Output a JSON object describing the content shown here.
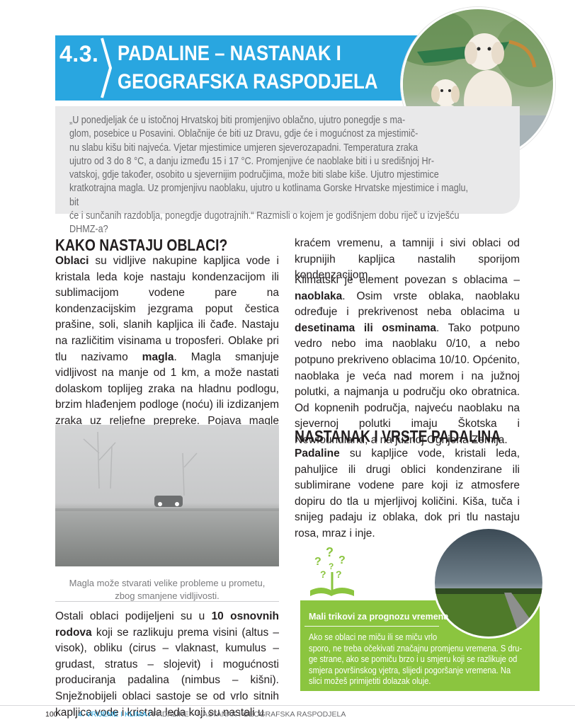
{
  "header": {
    "number": "4.3.",
    "title_line1": "PADALINE – NASTANAK I",
    "title_line2": "GEOGRAFSKA RASPODJELA"
  },
  "intro": {
    "lines": [
      "„U ponedjeljak će u istočnoj Hrvatskoj biti promjenjivo oblačno, ujutro ponegdje s ma-",
      "glom, posebice u Posavini. Oblačnije će biti uz Dravu, gdje će i mogućnost za mjestimič-",
      "nu slabu kišu biti najveća. Vjetar mjestimice umjeren sjeverozapadni. Temperatura zraka",
      "ujutro od 3 do 8 °C, a danju između 15 i 17 °C. Promjenjive će naoblake biti i u središnjoj Hr-",
      "vatskoj, gdje također, osobito u sjevernijim područjima, može biti slabe kiše. Ujutro mjestimice",
      "kratkotrajna magla. Uz promjenjivu naoblaku, ujutro u kotlinama Gorske Hrvatske mjestimice i maglu, bit",
      "će i sunčanih razdoblja, ponegdje dugotrajnih.“ Razmisli o kojem je godišnjem dobu riječ u izvješću DHMZ-a?"
    ]
  },
  "section1": {
    "heading": "KAKO NASTAJU OBLACI?",
    "p1": {
      "t1": "Oblaci",
      "t2": " su vidljive nakupine kapljica vode i kristala leda koje nastaju kondenzacijom ili sublimacijom vodene pare na kondenzacijskim jezgrama poput čestica prašine, soli, slanih kapljica ili čađe. Nastaju na različitim visinama u troposferi. Oblake pri tlu nazivamo ",
      "t3": "magla",
      "t4": ". Magla smanjuje vidljivost na manje od 1 km, a može nastati dolaskom toplijeg zraka na hladnu podlogu, brzim hlađenjem podloge (noću) ili izdizanjem zraka uz reljefne prepreke. Pojava magle iznad mora češća je u toplom dijelu godine, dok je na kopnu češća zimi."
    },
    "caption_line1": "Magla može stvarati velike probleme u prometu,",
    "caption_line2": "zbog smanjene vidljivosti.",
    "p2": {
      "t1": "Ostali oblaci podijeljeni su u ",
      "t2": "10 osnovnih rodova",
      "t3": " koji se razlikuju prema visini (altus – visok), obliku (cirus – vlaknast, kumulus – grudast, stratus – slojevit) i mogućnosti produciranja padalina (nimbus – kišni). Snježnobijeli oblaci sastoje se od vrlo sitnih kapljica vode i kristala leda koji su nastali u"
    }
  },
  "right_col": {
    "p1": "kraćem vremenu, a tamniji i sivi oblaci od krupnijih kapljica nastalih sporijom kondenzacijom.",
    "p2": {
      "t1": "Klimatski je element povezan s oblacima – ",
      "t2": "naoblaka",
      "t3": ". Osim vrste oblaka, naoblaku određuje i prekrivenost neba oblacima u ",
      "t4": "desetinama ili osminama",
      "t5": ". Tako potpuno vedro nebo ima naoblaku 0/10, a nebo potpuno prekriveno oblacima 10/10. Općenito, naoblaka je veća nad morem i na južnoj polutki, a najmanja u području oko obratnica. Od kopnenih područja, najveću naoblaku na sjevernoj polutki imaju Škotska i Newfoundland, a na južnoj Ognjena Zemlja."
    }
  },
  "section2": {
    "heading": "NASTANAK I VRSTE PADALINA",
    "p1": {
      "t1": "Padaline",
      "t2": " su kapljice vode, kristali leda, pahuljice ili drugi oblici kondenzirane ili sublimirane vodene pare koji iz atmosfere dopiru do tla u mjerljivoj količini. Kiša, tuča i snijeg padaju iz oblaka, dok pri tlu nastaju rosa, mraz i inje."
    }
  },
  "tip": {
    "heading": "Mali trikovi za prognozu vremena",
    "lines": [
      "Ako se oblaci ne miču ili se miču vrlo",
      "sporo, ne treba očekivati značajnu promjenu vremena. S dru-",
      "ge strane, ako se pomiču brzo i u smjeru koji se razlikuje od",
      "smjera površinskog vjetra, slijedi pogoršanje vremena. Na",
      "slici možeš primijetiti dolazak oluje."
    ]
  },
  "footer": {
    "page": "100",
    "chapter": "4. VRIJEME I KLIMA",
    "separator": " / ",
    "section": "PADALINE – NASTANAK I GEOGRAFSKA RASPODJELA"
  },
  "colors": {
    "header_blue": "#29a6e0",
    "tip_green": "#8bc53f",
    "intro_grey": "#e9e9ea"
  }
}
